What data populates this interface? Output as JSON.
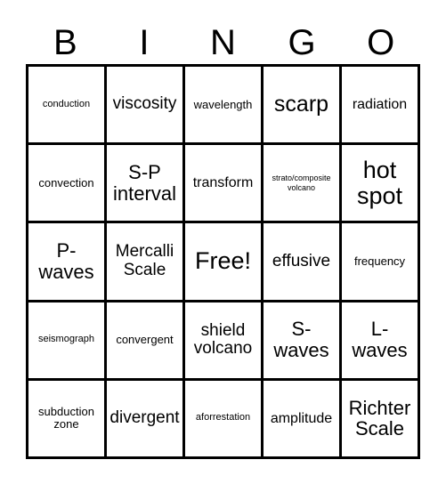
{
  "card": {
    "title": "BINGO",
    "header_letters": [
      "B",
      "I",
      "N",
      "G",
      "O"
    ],
    "colors": {
      "border": "#000000",
      "background": "#ffffff",
      "text": "#000000"
    },
    "rows": [
      [
        {
          "label": "conduction",
          "size": "sm"
        },
        {
          "label": "viscosity",
          "size": "xl"
        },
        {
          "label": "wavelength",
          "size": "md"
        },
        {
          "label": "scarp",
          "size": "3xl"
        },
        {
          "label": "radiation",
          "size": "lg"
        }
      ],
      [
        {
          "label": "convection",
          "size": "md"
        },
        {
          "label": "S-P\ninterval",
          "size": "2xl"
        },
        {
          "label": "transform",
          "size": "lg"
        },
        {
          "label": "strato/composite\nvolcano",
          "size": "xs"
        },
        {
          "label": "hot\nspot",
          "size": "4xl"
        }
      ],
      [
        {
          "label": "P-\nwaves",
          "size": "2xl"
        },
        {
          "label": "Mercalli\nScale",
          "size": "xl"
        },
        {
          "label": "Free!",
          "size": "4xl"
        },
        {
          "label": "effusive",
          "size": "xl"
        },
        {
          "label": "frequency",
          "size": "md"
        }
      ],
      [
        {
          "label": "seismograph",
          "size": "sm"
        },
        {
          "label": "convergent",
          "size": "md"
        },
        {
          "label": "shield\nvolcano",
          "size": "xl"
        },
        {
          "label": "S-\nwaves",
          "size": "2xl"
        },
        {
          "label": "L-\nwaves",
          "size": "2xl"
        }
      ],
      [
        {
          "label": "subduction\nzone",
          "size": "md"
        },
        {
          "label": "divergent",
          "size": "xl"
        },
        {
          "label": "aforrestation",
          "size": "sm"
        },
        {
          "label": "amplitude",
          "size": "lg"
        },
        {
          "label": "Richter\nScale",
          "size": "2xl"
        }
      ]
    ]
  }
}
